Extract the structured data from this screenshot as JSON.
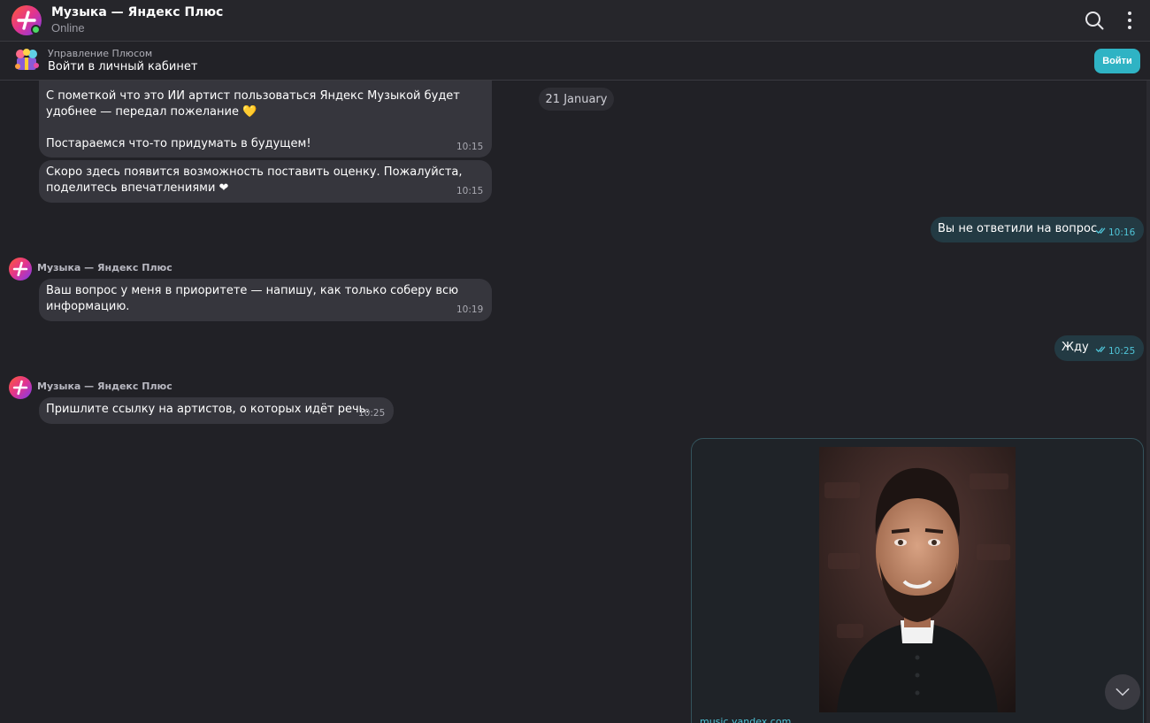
{
  "header": {
    "title": "Музыка — Яндекс Плюс",
    "status": "Online"
  },
  "banner": {
    "subtitle": "Управление Плюсом",
    "title": "Войти в личный кабинет",
    "login_label": "Войти"
  },
  "date_chip": "21 January",
  "messages": [
    {
      "dir": "in",
      "lines": [
        "С пометкой что это ИИ артист пользоваться Яндекс Музыкой будет",
        "удобнее — передал пожелание 💛",
        "",
        "Постараемся что-то придумать в будущем!"
      ],
      "time": "10:15"
    },
    {
      "dir": "in",
      "lines": [
        "Скоро здесь появится возможность поставить оценку. Пожалуйста,",
        "поделитесь впечатлениями ❤"
      ],
      "time": "10:15"
    },
    {
      "dir": "out",
      "text": "Вы не ответили на вопрос",
      "time": "10:16"
    },
    {
      "dir": "in",
      "sender": "Музыка — Яндекс Плюс",
      "lines": [
        "Ваш вопрос у меня в приоритете — напишу, как только соберу всю",
        "информацию."
      ],
      "time": "10:19"
    },
    {
      "dir": "out",
      "text": "Жду",
      "time": "10:25"
    },
    {
      "dir": "in",
      "sender": "Музыка — Яндекс Плюс",
      "lines": [
        "Пришлите ссылку на артистов, о которых идёт речь."
      ],
      "time": "10:25"
    }
  ],
  "card": {
    "link": "music.yandex.com"
  },
  "colors": {
    "background": "#212126",
    "bubble_in": "#36363d",
    "bubble_out": "#233a43",
    "accent": "#4fc3d6",
    "login_button": "#2fb3c4",
    "online": "#4cd964"
  },
  "icons": [
    "plus-logo-icon",
    "search-icon",
    "more-vertical-icon",
    "plus-gift-icon",
    "double-check-icon",
    "chevron-down-icon"
  ]
}
